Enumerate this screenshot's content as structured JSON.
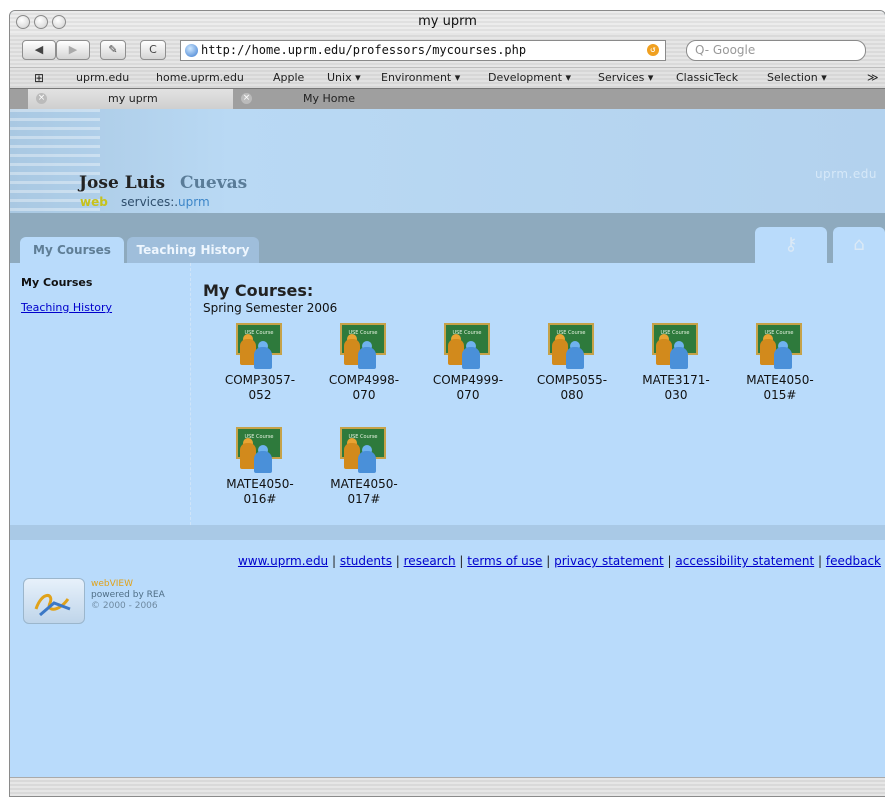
{
  "window": {
    "title": "my uprm"
  },
  "toolbar": {
    "back_label": "◀",
    "forward_label": "▶",
    "edit_label": "✎",
    "reload_label": "C",
    "url": "http://home.uprm.edu/professors/mycourses.php",
    "search_placeholder": "Q- Google"
  },
  "bookmarks": [
    "uprm.edu",
    "home.uprm.edu",
    "Apple",
    "Unix ▾",
    "Environment ▾",
    "Development ▾",
    "Services ▾",
    "ClassicTeck",
    "Selection ▾",
    "≫"
  ],
  "browser_tabs": [
    {
      "label": "my uprm",
      "active": true
    },
    {
      "label": "My Home",
      "active": false
    }
  ],
  "header": {
    "first_name": "Jose Luis",
    "last_name": "Cuevas",
    "sub_web": "web",
    "sub_services": "services:.",
    "sub_uprm": "uprm",
    "brand": "uprm.edu"
  },
  "page_tabs": [
    {
      "label": "My Courses",
      "active": true
    },
    {
      "label": "Teaching History",
      "active": false
    }
  ],
  "icon_tabs": [
    {
      "icon": "key-icon"
    },
    {
      "icon": "home-icon"
    }
  ],
  "left_nav": {
    "title": "My Courses",
    "link": "Teaching History"
  },
  "main": {
    "title": "My Courses:",
    "semester": "Spring Semester 2006",
    "board_label": "USE Course",
    "courses": [
      {
        "code": "COMP3057-",
        "section": "052"
      },
      {
        "code": "COMP4998-",
        "section": "070"
      },
      {
        "code": "COMP4999-",
        "section": "070"
      },
      {
        "code": "COMP5055-",
        "section": "080"
      },
      {
        "code": "MATE3171-",
        "section": "030"
      },
      {
        "code": "MATE4050-",
        "section": "015#"
      },
      {
        "code": "MATE4050-",
        "section": "016#"
      },
      {
        "code": "MATE4050-",
        "section": "017#"
      }
    ]
  },
  "footer": {
    "links": [
      "www.uprm.edu",
      "students",
      "research",
      "terms of use",
      "privacy statement",
      "accessibility statement",
      "feedback"
    ],
    "separator": " | ",
    "logo_line1": "webVIEW",
    "logo_line2": "powered by REA",
    "logo_line3": "© 2000 - 2006"
  }
}
